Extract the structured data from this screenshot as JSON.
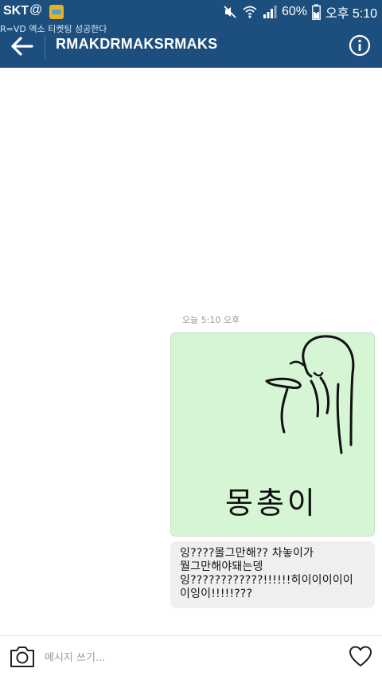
{
  "status_bar": {
    "carrier": "SKT",
    "at_symbol": "@",
    "battery": "60%",
    "time": "오후 5:10",
    "ticker": "R=VD 엑소 티켓팅 성공한다",
    "icons": [
      "app-notification-icon",
      "mute-icon",
      "wifi-icon",
      "signal-icon",
      "battery-icon"
    ]
  },
  "header": {
    "title": "RMAKDRMAKSRMAKS",
    "icons": [
      "back-arrow-icon",
      "info-icon"
    ]
  },
  "chat": {
    "timestamp": "오늘 5:10 오후",
    "image_caption": "몽총이",
    "message_lines": [
      "잉????몰그만해?? 차놓이가",
      "뭘그만해야돼는뎅",
      "잉????????????!!!!!!히이이이이이",
      "이잉이!!!!!???"
    ]
  },
  "composer": {
    "placeholder": "메시지 쓰기...",
    "icons": [
      "camera-icon",
      "heart-icon"
    ]
  },
  "colors": {
    "bar": "#1c4f7e",
    "image_bg": "#d6f5d4",
    "bubble": "#efefef"
  }
}
